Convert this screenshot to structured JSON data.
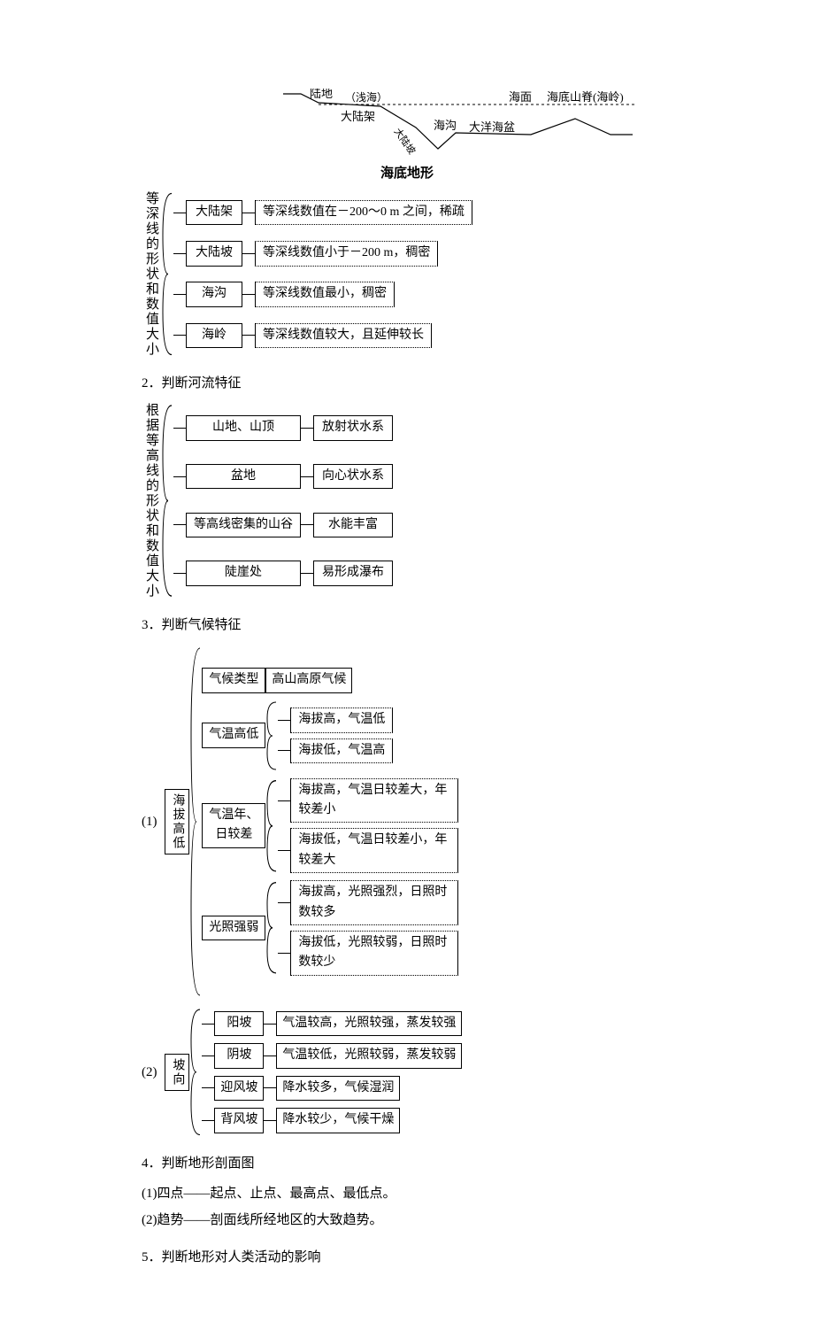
{
  "seabed": {
    "land": "陆地",
    "shallow": "（浅海）",
    "shelf": "大陆架",
    "slope": "大陆坡",
    "trench": "海沟",
    "surface": "海面",
    "basin": "大洋海盆",
    "ridge": "海底山脊(海岭)",
    "caption": "海底地形"
  },
  "table1": {
    "root": "等深线的形状和数值大小",
    "rows": [
      {
        "label": "大陆架",
        "desc": "等深线数值在－200～0 m 之间，稀疏"
      },
      {
        "label": "大陆坡",
        "desc": "等深线数值小于－200 m，稠密"
      },
      {
        "label": "海沟",
        "desc": "等深线数值最小，稠密"
      },
      {
        "label": "海岭",
        "desc": "等深线数值较大，且延伸较长"
      }
    ]
  },
  "s2": {
    "title": "2．判断河流特征",
    "root": "根据等高线的形状和数值大小",
    "rows": [
      {
        "label": "山地、山顶",
        "desc": "放射状水系"
      },
      {
        "label": "盆地",
        "desc": "向心状水系"
      },
      {
        "label": "等高线密集的山谷",
        "desc": "水能丰富"
      },
      {
        "label": "陡崖处",
        "desc": "易形成瀑布"
      }
    ]
  },
  "s3": {
    "title": "3．判断气候特征",
    "n1": "(1)",
    "n2": "(2)",
    "rootA": "海拔高低",
    "rootB": "坡向",
    "branchesA": [
      {
        "label": "气候类型",
        "children": [
          {
            "desc": "高山高原气候"
          }
        ]
      },
      {
        "label": "气温高低",
        "children": [
          {
            "desc": "海拔高，气温低"
          },
          {
            "desc": "海拔低，气温高"
          }
        ]
      },
      {
        "label": "气温年、日较差",
        "children": [
          {
            "desc": "海拔高，气温日较差大，年较差小"
          },
          {
            "desc": "海拔低，气温日较差小，年较差大"
          }
        ]
      },
      {
        "label": "光照强弱",
        "children": [
          {
            "desc": "海拔高，光照强烈，日照时数较多"
          },
          {
            "desc": "海拔低，光照较弱，日照时数较少"
          }
        ]
      }
    ],
    "branchesB": [
      {
        "label": "阳坡",
        "desc": "气温较高，光照较强，蒸发较强"
      },
      {
        "label": "阴坡",
        "desc": "气温较低，光照较弱，蒸发较弱"
      },
      {
        "label": "迎风坡",
        "desc": "降水较多，气候湿润"
      },
      {
        "label": "背风坡",
        "desc": "降水较少，气候干燥"
      }
    ]
  },
  "s4": {
    "title": "4．判断地形剖面图",
    "p1": "(1)四点——起点、止点、最高点、最低点。",
    "p2": "(2)趋势——剖面线所经地区的大致趋势。"
  },
  "s5": {
    "title": "5．判断地形对人类活动的影响"
  }
}
